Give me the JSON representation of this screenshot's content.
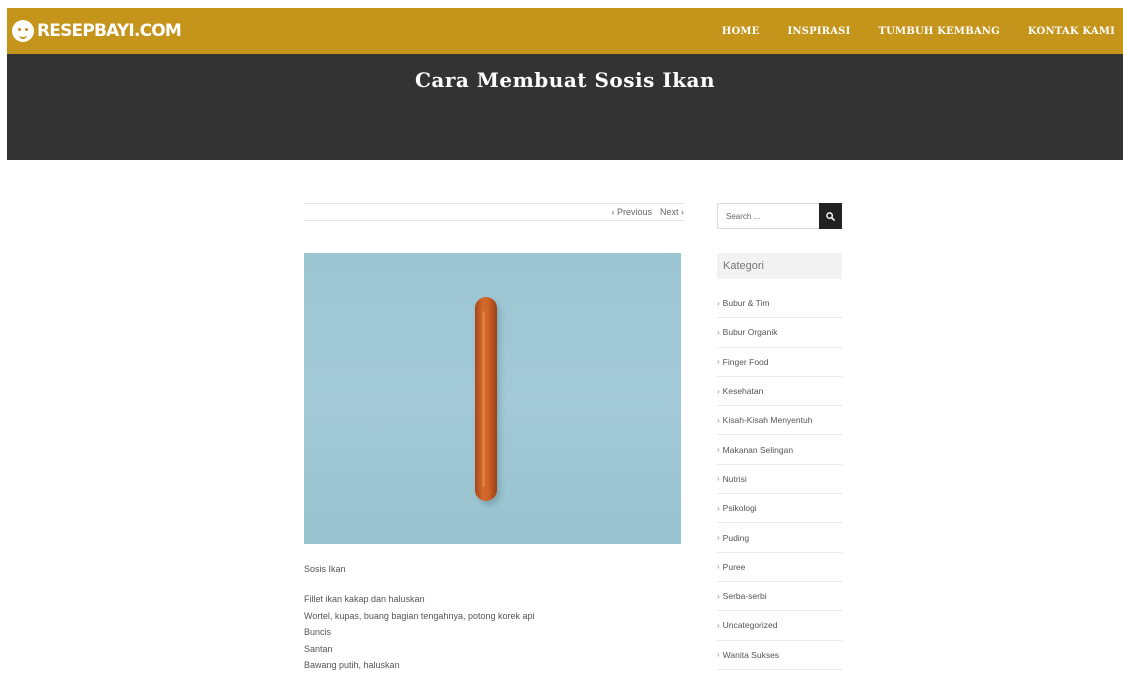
{
  "header": {
    "logo_text": "RESEPBAYI.COM",
    "nav": [
      "HOME",
      "INSPIRASI",
      "TUMBUH KEMBANG",
      "KONTAK KAMI"
    ]
  },
  "banner": {
    "title": "Cara Membuat Sosis Ikan"
  },
  "post_nav": {
    "previous": "‹ Previous",
    "next": "Next ›"
  },
  "post": {
    "caption": "Sosis Ikan",
    "ingredients": [
      "Fillet ikan kakap dan haluskan",
      "Wortel, kupas, buang bagian tengahnya, potong korek api",
      "Buncis",
      "Santan",
      "Bawang putih, haluskan"
    ]
  },
  "sidebar": {
    "search_placeholder": "Search ...",
    "kategori_title": "Kategori",
    "categories": [
      "Bubur & Tim",
      "Bubur Organik",
      "Finger Food",
      "Kesehatan",
      "Kisah-Kisah Menyentuh",
      "Makanan Selingan",
      "Nutrisi",
      "Psikologi",
      "Puding",
      "Puree",
      "Serba-serbi",
      "Uncategorized",
      "Wanita Sukses"
    ]
  },
  "colors": {
    "header_bg": "#c5941a",
    "banner_bg": "#333333",
    "image_bg": "#9cc6d2"
  }
}
